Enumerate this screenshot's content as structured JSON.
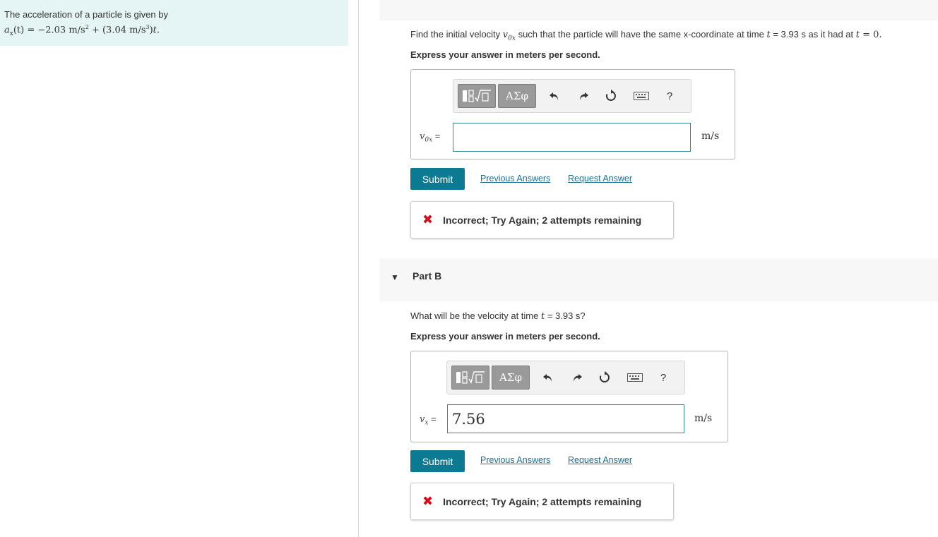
{
  "problem": {
    "line1": "The acceleration of a particle is given by",
    "eq": {
      "lhs": "a",
      "sub": "x",
      "arg": "(t) = −2.03 m/s",
      "exp1": "2",
      "mid": " + (3.04 m/s",
      "exp2": "3",
      "tail": ")",
      "t": "t",
      "period": "."
    }
  },
  "partA": {
    "question_pre": "Find the initial velocity ",
    "var": "v",
    "var_sub": "0x",
    "question_mid": " such that the particle will have the same x-coordinate at time ",
    "t1": "t",
    "question_val": " = 3.93 s as it had at ",
    "t2": "t",
    "question_end": " = 0.",
    "instruction": "Express your answer in meters per second.",
    "toolbar": {
      "greek": "ΑΣφ",
      "help": "?"
    },
    "input_label_var": "v",
    "input_label_sub": "0x",
    "input_label_eq": " =",
    "input_value": "",
    "unit": "m/s",
    "submit_label": "Submit",
    "prev_answers": "Previous Answers",
    "request_answer": "Request Answer",
    "feedback": "Incorrect; Try Again; 2 attempts remaining"
  },
  "partB": {
    "title": "Part B",
    "question_pre": "What will be the velocity at time ",
    "t": "t",
    "question_end": " = 3.93 s?",
    "instruction": "Express your answer in meters per second.",
    "toolbar": {
      "greek": "ΑΣφ",
      "help": "?"
    },
    "input_label_var": "v",
    "input_label_sub": "x",
    "input_label_eq": " =",
    "input_value": "7.56",
    "unit": "m/s",
    "submit_label": "Submit",
    "prev_answers": "Previous Answers",
    "request_answer": "Request Answer",
    "feedback": "Incorrect; Try Again; 2 attempts remaining"
  },
  "colors": {
    "accent": "#0c7a92",
    "link": "#1b6f95",
    "error": "#d0111b",
    "problem_bg": "#e5f4f5"
  },
  "icons": {
    "template": "template-icon",
    "undo": "undo-icon",
    "redo": "redo-icon",
    "reset": "reset-icon",
    "keyboard": "keyboard-icon",
    "help": "help-icon",
    "incorrect": "x-icon",
    "collapse": "caret-down-icon"
  }
}
